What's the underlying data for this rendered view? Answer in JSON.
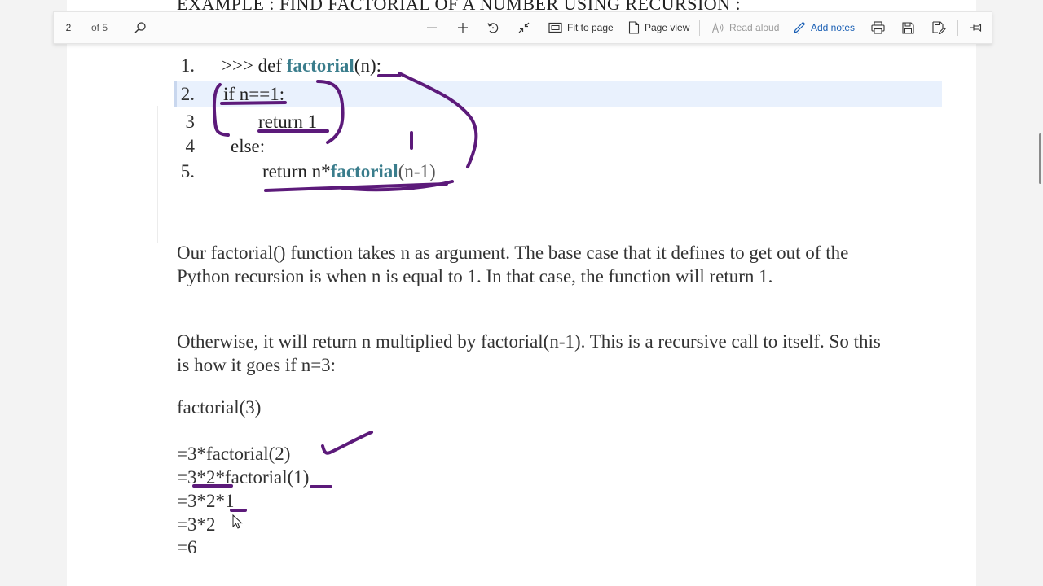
{
  "toolbar": {
    "page_number": "2",
    "page_count": "of 5",
    "fit_to_page": "Fit to page",
    "page_view": "Page view",
    "read_aloud": "Read aloud",
    "add_notes": "Add notes"
  },
  "document": {
    "heading_cut": "EXAMPLE : FIND FACTORIAL OF A NUMBER USING RECURSION :",
    "code": [
      {
        "num": "1.",
        "parts": [
          ">>> def ",
          "factorial",
          "(n):"
        ]
      },
      {
        "num": "2.",
        "text": "if n==1:"
      },
      {
        "num": "3",
        "text": "return 1"
      },
      {
        "num": "4",
        "text": "else:"
      },
      {
        "num": "5.",
        "parts": [
          "return n*",
          "factorial",
          "(n-1)"
        ]
      }
    ],
    "para1": "Our factorial() function takes n as argument. The base case that it defines to get out of the Python recursion is when n is equal to 1. In that case, the function will return 1.",
    "para2": "Otherwise, it will return n multiplied by factorial(n-1). This is a recursive call to itself. So this is how it goes if n=3:",
    "call": "factorial(3)",
    "steps": [
      "=3*factorial(2)",
      "=3*2*factorial(1)",
      "=3*2*1",
      "=3*2",
      "=6"
    ]
  },
  "colors": {
    "ink": "#5c1a7a",
    "function_name": "#3a7d8c",
    "highlight": "#e9f1fd",
    "accent": "#1a5fb4"
  }
}
